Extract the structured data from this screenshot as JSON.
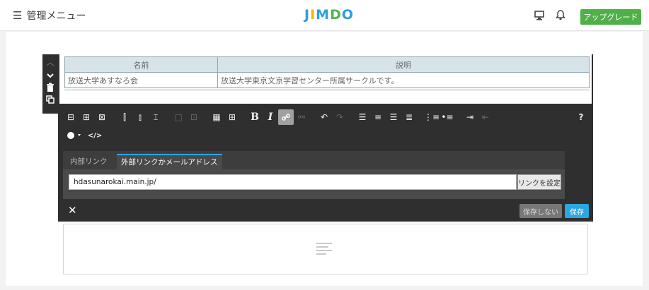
{
  "header": {
    "menu_label": "管理メニュー",
    "logo_text": "JIMDO",
    "upgrade_label": "アップグレード",
    "icons": [
      "hamburger-icon",
      "monitor-icon",
      "bell-icon"
    ]
  },
  "side_toolbar": {
    "icons": [
      "chevron-up-icon",
      "chevron-down-icon",
      "trash-icon",
      "copy-icon"
    ]
  },
  "table": {
    "headers": [
      "名前",
      "説明"
    ],
    "rows": [
      [
        "放送大学あすなろ会",
        "放送大学東京文京学習センター所属サークルです。"
      ]
    ]
  },
  "toolbar": {
    "bold_label": "B",
    "italic_label": "I",
    "help_label": "?",
    "source_label": "</>"
  },
  "link_panel": {
    "tabs": [
      "内部リンク",
      "外部リンクかメールアドレス"
    ],
    "active_tab": 1,
    "url_value": "hdasunarokai.main.jp/",
    "set_link_label": "リンクを設定"
  },
  "footer": {
    "close_label": "✕",
    "discard_label": "保存しない",
    "save_label": "保存"
  },
  "colors": {
    "upgrade": "#4fb047",
    "accent": "#2aa7e0",
    "editor_bg": "#2f2f2f"
  }
}
